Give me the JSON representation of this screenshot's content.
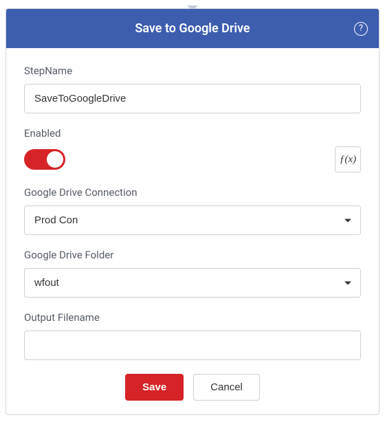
{
  "header": {
    "title": "Save to Google Drive",
    "help_symbol": "?"
  },
  "form": {
    "stepName": {
      "label": "StepName",
      "value": "SaveToGoogleDrive"
    },
    "enabled": {
      "label": "Enabled",
      "on": true,
      "fx_label": "ƒ(x)"
    },
    "connection": {
      "label": "Google Drive Connection",
      "value": "Prod Con"
    },
    "folder": {
      "label": "Google Drive Folder",
      "value": "wfout"
    },
    "outputFilename": {
      "label": "Output Filename",
      "value": ""
    }
  },
  "actions": {
    "save": "Save",
    "cancel": "Cancel"
  }
}
